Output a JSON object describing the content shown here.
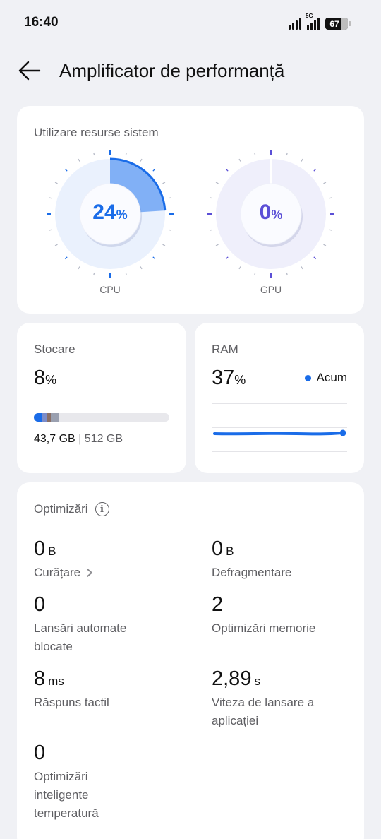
{
  "status_bar": {
    "time": "16:40",
    "network_tag": "5G",
    "battery": "67"
  },
  "header": {
    "title": "Amplificator de performanță"
  },
  "resources": {
    "title": "Utilizare resurse sistem",
    "cpu": {
      "label": "CPU",
      "value": "24",
      "unit": "%",
      "fraction": 0.24,
      "color": "#1a6ce8"
    },
    "gpu": {
      "label": "GPU",
      "value": "0",
      "unit": "%",
      "fraction": 0,
      "color": "#5b4fd6"
    }
  },
  "storage": {
    "title": "Stocare",
    "percent": "8",
    "unit": "%",
    "used": "43,7 GB",
    "separator": "|",
    "total": "512 GB",
    "fill_fraction": 0.08
  },
  "ram": {
    "title": "RAM",
    "percent": "37",
    "unit": "%",
    "legend": "Acum"
  },
  "optimizations": {
    "title": "Optimizări",
    "items": [
      {
        "value": "0",
        "unit": "B",
        "label": "Curățare",
        "link": true
      },
      {
        "value": "0",
        "unit": "B",
        "label": "Defragmentare"
      },
      {
        "value": "0",
        "unit": "",
        "label": "Lansări automate blocate"
      },
      {
        "value": "2",
        "unit": "",
        "label": "Optimizări memorie"
      },
      {
        "value": "8",
        "unit": "ms",
        "label": "Răspuns tactil"
      },
      {
        "value": "2,89",
        "unit": "s",
        "label": "Viteza de lansare a aplicației"
      },
      {
        "value": "0",
        "unit": "",
        "label": "Optimizări inteligente temperatură"
      }
    ]
  },
  "icons": {
    "back": "arrow-left-icon",
    "info": "info-icon",
    "chevron": "chevron-right-icon"
  }
}
